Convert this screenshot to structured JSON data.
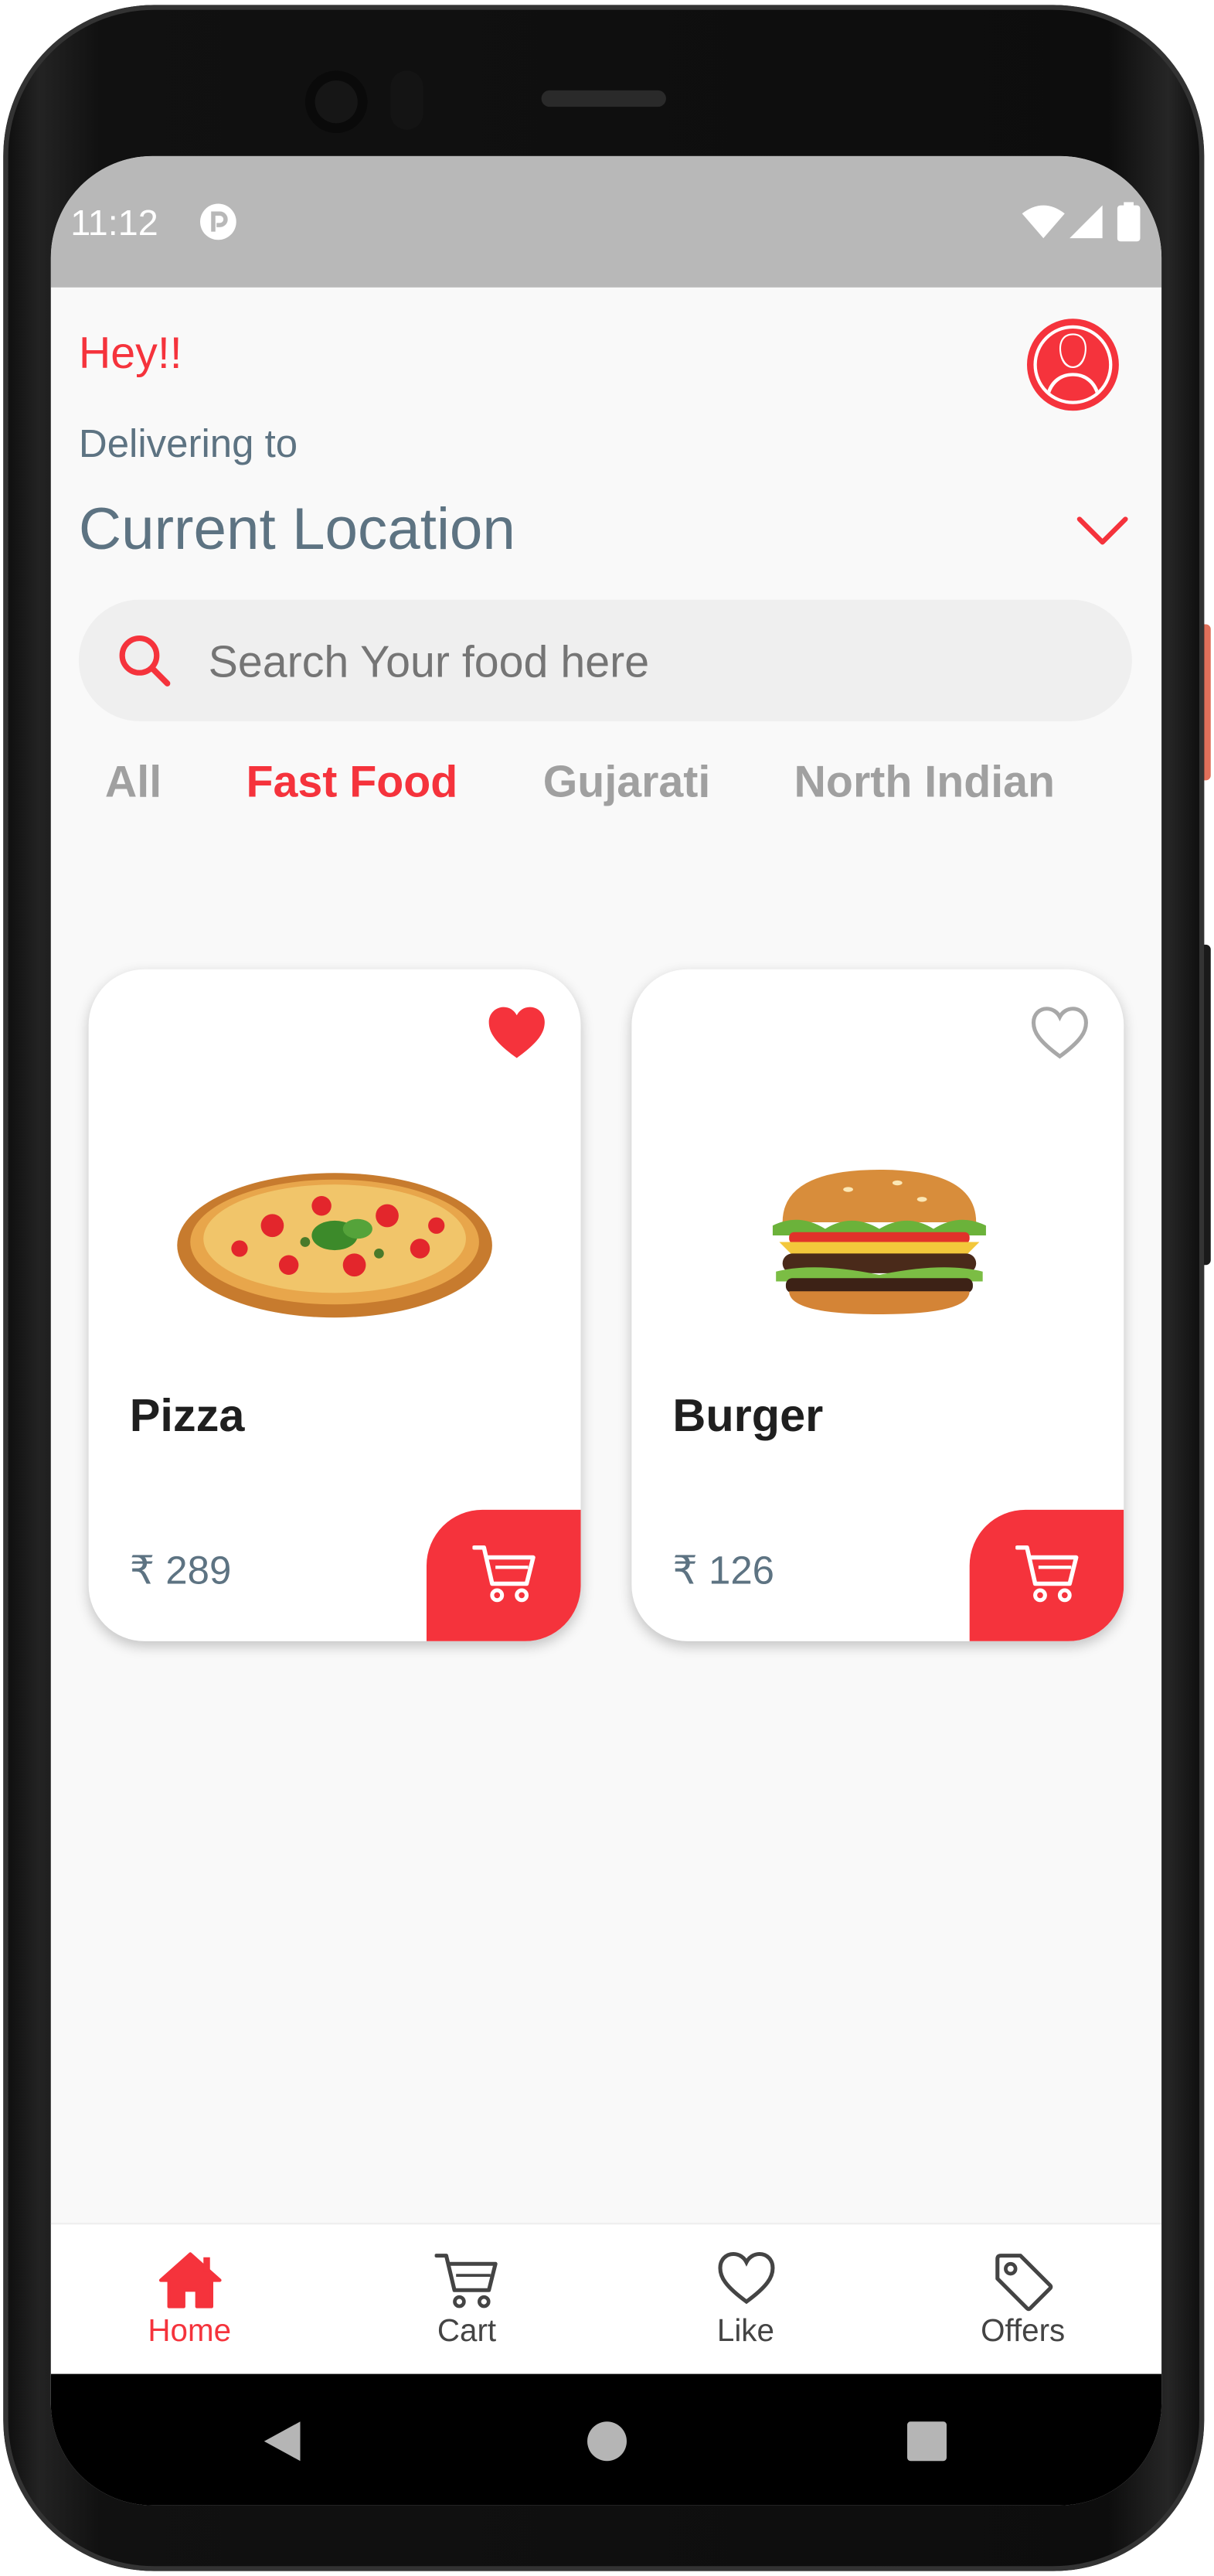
{
  "status_bar": {
    "time": "11:12",
    "icons": [
      "notification-app-icon",
      "wifi-icon",
      "cellular-signal-icon",
      "battery-icon"
    ]
  },
  "header": {
    "greeting": "Hey!!",
    "delivering_label": "Delivering to",
    "location": "Current Location",
    "profile_icon": "user-profile-icon",
    "dropdown_icon": "chevron-down-icon"
  },
  "search": {
    "placeholder": "Search Your food here",
    "icon": "search-icon"
  },
  "categories": [
    {
      "label": "All",
      "selected": false
    },
    {
      "label": "Fast Food",
      "selected": true
    },
    {
      "label": "Gujarati",
      "selected": false
    },
    {
      "label": "North Indian",
      "selected": false
    }
  ],
  "products": [
    {
      "name": "Pizza",
      "price": "₹ 289",
      "liked": true,
      "image": "pizza-image"
    },
    {
      "name": "Burger",
      "price": "₹ 126",
      "liked": false,
      "image": "burger-image"
    }
  ],
  "bottom_nav": [
    {
      "label": "Home",
      "icon": "home-icon",
      "active": true
    },
    {
      "label": "Cart",
      "icon": "cart-icon",
      "active": false
    },
    {
      "label": "Like",
      "icon": "heart-icon",
      "active": false
    },
    {
      "label": "Offers",
      "icon": "tag-icon",
      "active": false
    }
  ],
  "system_nav": [
    "back-icon",
    "home-circle-icon",
    "recents-icon"
  ],
  "colors": {
    "accent": "#f5333c",
    "text_secondary": "#5d7382",
    "category_inactive": "#a0a0a0",
    "background": "#f9f9f9",
    "status_bar": "#b8b8b8"
  }
}
